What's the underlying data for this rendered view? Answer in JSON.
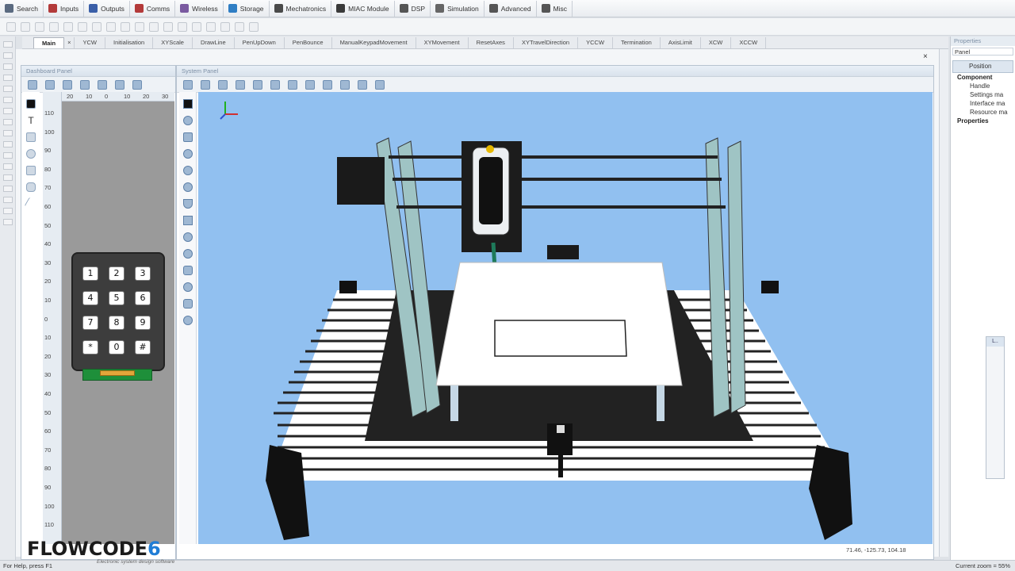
{
  "menu": [
    {
      "label": "Search",
      "icon": "search-icon",
      "color": "#5a6a80"
    },
    {
      "label": "Inputs",
      "icon": "inputs-icon",
      "color": "#b33a3a"
    },
    {
      "label": "Outputs",
      "icon": "outputs-icon",
      "color": "#3a5fa8"
    },
    {
      "label": "Comms",
      "icon": "comms-icon",
      "color": "#b33a3a"
    },
    {
      "label": "Wireless",
      "icon": "wireless-icon",
      "color": "#7a5aa0"
    },
    {
      "label": "Storage",
      "icon": "storage-icon",
      "color": "#2f7ec4"
    },
    {
      "label": "Mechatronics",
      "icon": "mechatronics-icon",
      "color": "#4a4a4a"
    },
    {
      "label": "MIAC Module",
      "icon": "miac-icon",
      "color": "#3a3a3a"
    },
    {
      "label": "DSP",
      "icon": "dsp-icon",
      "color": "#555"
    },
    {
      "label": "Simulation",
      "icon": "simulation-icon",
      "color": "#666"
    },
    {
      "label": "Advanced",
      "icon": "advanced-icon",
      "color": "#555"
    },
    {
      "label": "Misc",
      "icon": "misc-icon",
      "color": "#555"
    }
  ],
  "tabs": [
    "Main",
    "YCW",
    "Initialisation",
    "XYScale",
    "DrawLine",
    "PenUpDown",
    "PenBounce",
    "ManualKeypadMovement",
    "XYMovement",
    "ResetAxes",
    "XYTravelDirection",
    "YCCW",
    "Termination",
    "AxisLimit",
    "XCW",
    "XCCW"
  ],
  "tab_close": "×",
  "dashboard": {
    "title": "Dashboard Panel",
    "hticks": [
      "20",
      "10",
      "0",
      "10",
      "20",
      "30"
    ],
    "vticks": [
      "110",
      "100",
      "90",
      "80",
      "70",
      "60",
      "50",
      "40",
      "30",
      "20",
      "10",
      "0",
      "10",
      "20",
      "30",
      "40",
      "50",
      "60",
      "70",
      "80",
      "90",
      "100",
      "110"
    ],
    "keys": [
      "1",
      "2",
      "3",
      "4",
      "5",
      "6",
      "7",
      "8",
      "9",
      "*",
      "0",
      "#"
    ]
  },
  "system": {
    "title": "System Panel",
    "coords": "71.46, -125.73, 104.18",
    "close": "×"
  },
  "properties": {
    "header": "Properties",
    "selector": "Panel",
    "tab": "Position",
    "tree_component": "Component",
    "tree_items": [
      "Handle",
      "Settings ma",
      "Interface ma",
      "Resource ma"
    ],
    "tree_properties": "Properties"
  },
  "mini": {
    "title": "L.."
  },
  "status": {
    "help": "For Help, press F1",
    "zoom": "Current zoom = 55%"
  },
  "brand": {
    "name": "FLOWCODE",
    "version": "6",
    "tagline": "Electronic system design software"
  },
  "colors": {
    "viewport": "#91c0f0",
    "accent": "#1f7dd6"
  }
}
